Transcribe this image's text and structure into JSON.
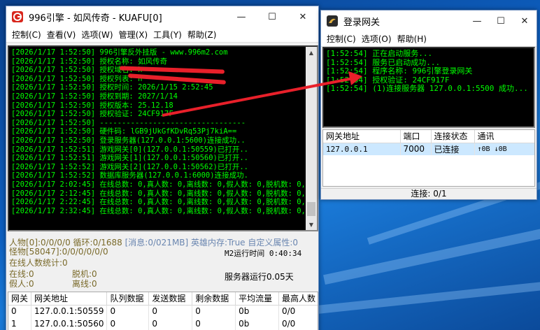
{
  "main_window": {
    "title": "996引擎 - 如风传奇 - KUAFU[0]",
    "menu": [
      "控制(C)",
      "查看(V)",
      "选项(W)",
      "管理(X)",
      "工具(Y)",
      "帮助(Z)"
    ],
    "console_lines": [
      "[2026/1/17 1:52:50] 996引擎反外挂版 - www.996m2.com",
      "[2026/1/17 1:52:50] 授权名称: 如风传奇",
      "[2026/1/17 1:52:50] 授权域名: h",
      "[2026/1/17 1:52:50] 授权列表: h",
      "[2026/1/17 1:52:50] 授权时间: 2026/1/15 2:52:45",
      "[2026/1/17 1:52:50] 授权到期: 2027/1/14",
      "[2026/1/17 1:52:50] 授权版本: 25.12.18",
      "[2026/1/17 1:52:50] 授权验证: 24CF917F",
      "[2026/1/17 1:52:50] ---------------------------------",
      "[2026/1/17 1:52:50] 硬件码: lGB9jUkGfKDvRq53Pj7kiA==",
      "[2026/1/17 1:52:50] 登录服务器(127.0.0.1:5600)连接成功..",
      "[2026/1/17 1:52:51] 游戏网关[0](127.0.0.1:50559)已打开..",
      "[2026/1/17 1:52:51] 游戏网关[1](127.0.0.1:50560)已打开..",
      "[2026/1/17 1:52:52] 游戏网关[2](127.0.0.1:50562)已打开..",
      "[2026/1/17 1:52:52] 数据库服务器(127.0.0.1:6000)连接成功.",
      "[2026/1/17 2:02:45] 在线总数: 0,真人数: 0,离线数: 0,假人数: 0,脱机数: 0,",
      "[2026/1/17 2:12:45] 在线总数: 0,真人数: 0,离线数: 0,假人数: 0,脱机数: 0,",
      "[2026/1/17 2:22:45] 在线总数: 0,真人数: 0,离线数: 0,假人数: 0,脱机数: 0,",
      "[2026/1/17 2:32:45] 在线总数: 0,真人数: 0,离线数: 0,假人数: 0,脱机数: 0,"
    ],
    "info": {
      "row1_a": "人物[0]:0/0/0/0 循环:0/1688",
      "row1_b": "[消息:0/0",
      "row1_c": "21MB] 英雄内存:True 自定义属性:0",
      "row2": "怪物[58047]:0/0/0/0/0/0",
      "m2_runtime": "M2运行时间 0:40:34",
      "online_stat": "在线人数统计:0",
      "online": "在线:0",
      "offline_bot": "脱机:0",
      "fake": "假人:0",
      "offline": "离线:0",
      "server_runtime": "服务器运行0.05天"
    },
    "table": {
      "headers": [
        "网关",
        "网关地址",
        "队列数据",
        "发送数据",
        "剩余数据",
        "平均流量",
        "最高人数"
      ],
      "rows": [
        [
          "0",
          "127.0.0.1:50559",
          "0",
          "0",
          "0",
          "0b",
          "0/0"
        ],
        [
          "1",
          "127.0.0.1:50560",
          "0",
          "0",
          "0",
          "0b",
          "0/0"
        ]
      ]
    }
  },
  "gate_window": {
    "title": "登录网关",
    "menu": [
      "控制(C)",
      "选项(O)",
      "帮助(H)"
    ],
    "console_lines": [
      "[1:52:54] 正在启动服务...",
      "[1:52:54] 服务已启动成功...",
      "[1:52:54] 程序名称: 996引擎登录网关",
      "[1:52:54] 授权验证: 24CF917F",
      "[1:52:54] (1)连接服务器 127.0.0.1:5500 成功..."
    ],
    "table": {
      "headers": [
        "网关地址",
        "端口",
        "连接状态",
        "通讯"
      ],
      "rows": [
        [
          "127.0.0.1",
          "7000",
          "已连接",
          "↑0B  ↓0B"
        ]
      ]
    },
    "status": "连接: 0/1"
  },
  "colors": {
    "console_text": "#00ff00",
    "console_bg": "#000000",
    "annotation_red": "#e8202a",
    "selection": "#cce8ff"
  },
  "icons": {
    "main_app": "996-engine-logo-icon",
    "gate_app": "login-gate-logo-icon"
  }
}
